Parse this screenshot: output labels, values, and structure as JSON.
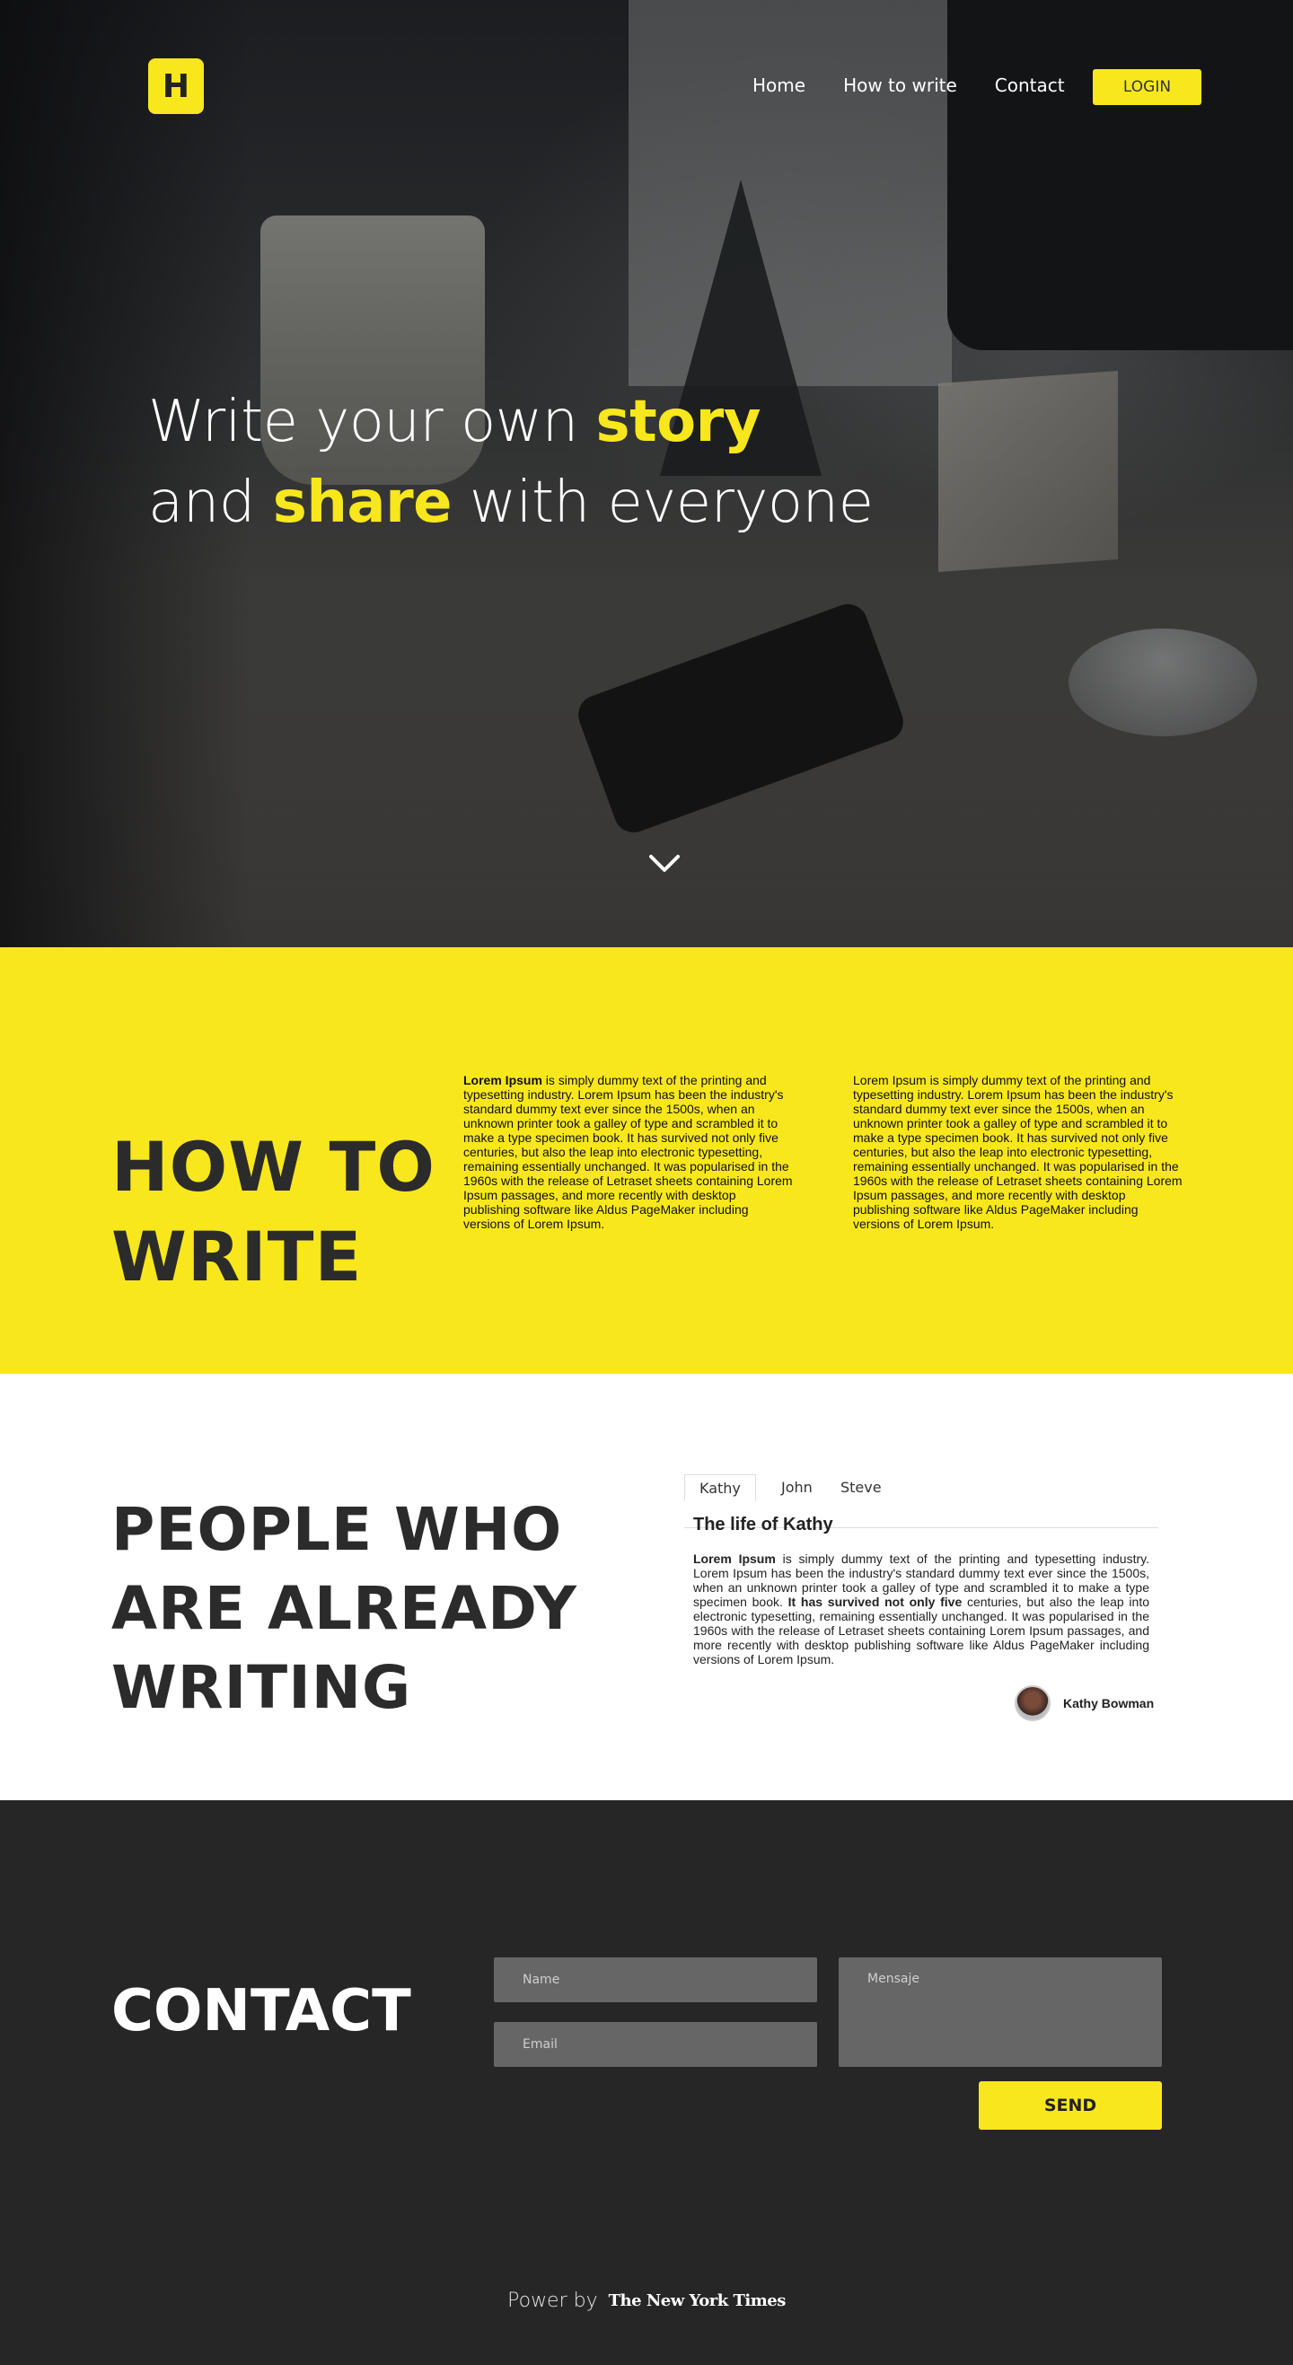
{
  "header": {
    "logo_letter": "H",
    "nav": [
      "Home",
      "How to write",
      "Contact"
    ],
    "login_label": "LOGIN"
  },
  "hero": {
    "line1_prefix": "Write your own ",
    "line1_highlight": "story",
    "line2_prefix": "and ",
    "line2_highlight": "share",
    "line2_suffix": " with everyone"
  },
  "how": {
    "title_line1": "HOW TO",
    "title_line2": "WRITE",
    "col1_bold": "Lorem Ipsum",
    "col1_text": " is simply dummy text of the printing and typesetting industry. Lorem Ipsum has been the industry's standard dummy text ever since the 1500s, when an unknown printer took a galley of type and scrambled it to make a type specimen book. It has survived not only five centuries, but also the leap into electronic typesetting, remaining essentially unchanged. It was popularised in the 1960s with the release of Letraset sheets containing Lorem Ipsum passages, and more recently with desktop publishing software like Aldus PageMaker including versions of Lorem Ipsum.",
    "col2_text": "Lorem Ipsum is simply dummy text of the printing and typesetting industry. Lorem Ipsum has been the industry's standard dummy text ever since the 1500s, when an unknown printer took a galley of type and scrambled it to make a type specimen book. It has survived not only five centuries, but also the leap into electronic typesetting, remaining essentially unchanged. It was popularised in the 1960s with the release of Letraset sheets containing Lorem Ipsum passages, and more recently with desktop publishing software like Aldus PageMaker including versions of Lorem Ipsum."
  },
  "people": {
    "title_line1": "PEOPLE WHO",
    "title_line2": "ARE ALREADY",
    "title_line3": "WRITING",
    "tabs": [
      "Kathy",
      "John",
      "Steve"
    ],
    "active_tab": "Kathy",
    "story_title": "The life of Kathy",
    "story_bold1": "Lorem Ipsum",
    "story_text1": " is simply dummy text of the printing and typesetting industry. Lorem Ipsum has been the industry's standard dummy text ever since the 1500s, when an unknown printer took a galley of type and scrambled it to make a type specimen book. ",
    "story_bold2": "It has survived not only five",
    "story_text2": " centuries, but also the leap into electronic typesetting,  remaining essentially unchanged. It was popularised in the 1960s with the release of Letraset sheets containing  Lorem Ipsum passages, and more recently with desktop    publishing software like Aldus PageMaker including  versions of Lorem Ipsum.",
    "author_name": "Kathy Bowman"
  },
  "contact": {
    "title": "CONTACT",
    "name_placeholder": "Name",
    "email_placeholder": "Email",
    "message_placeholder": "Mensaje",
    "send_label": "SEND"
  },
  "footer": {
    "power_by": "Power by",
    "brand": "The New York Times"
  },
  "colors": {
    "accent": "#f8e71c",
    "dark": "#262626",
    "field": "#666666"
  }
}
